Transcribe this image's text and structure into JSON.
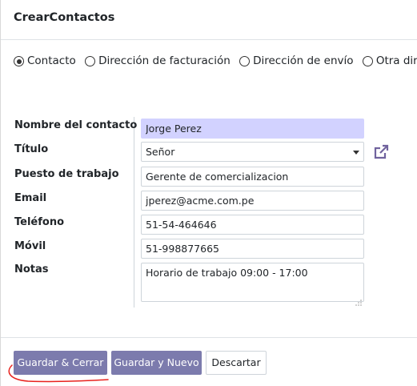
{
  "dialog": {
    "title": "CrearContactos"
  },
  "address_types": [
    {
      "label": "Contacto",
      "checked": true
    },
    {
      "label": "Dirección de facturación",
      "checked": false
    },
    {
      "label": "Dirección de envío",
      "checked": false
    },
    {
      "label": "Otra direcci",
      "checked": false
    }
  ],
  "form": {
    "name": {
      "label": "Nombre del contacto",
      "value": "Jorge Perez"
    },
    "title": {
      "label": "Título",
      "value": "Señor"
    },
    "job": {
      "label": "Puesto de trabajo",
      "value": "Gerente de comercializacion"
    },
    "email": {
      "label": "Email",
      "value": "jperez@acme.com.pe"
    },
    "phone": {
      "label": "Teléfono",
      "value": "51-54-464646"
    },
    "mobile": {
      "label": "Móvil",
      "value": "51-998877665"
    },
    "notes": {
      "label": "Notas",
      "value": "Horario de trabajo 09:00 - 17:00"
    }
  },
  "footer": {
    "save_close": "Guardar & Cerrar",
    "save_new": "Guardar y Nuevo",
    "discard": "Descartar"
  },
  "colors": {
    "primary": "#7c7bad",
    "highlight_field": "#d2d2ff",
    "annotation_red": "#e8231e",
    "external_link_icon": "#71639e"
  },
  "icons": {
    "title_dropdown": "chevron-down-icon",
    "external_link": "external-link-icon",
    "textarea_resize": "resize-grip-icon"
  }
}
